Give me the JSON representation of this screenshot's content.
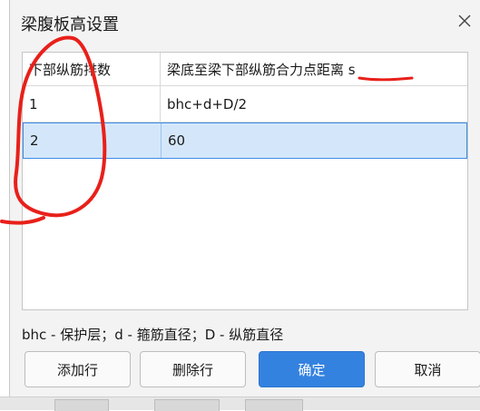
{
  "dialog": {
    "title": "梁腹板高设置",
    "close_icon": "close-icon"
  },
  "table": {
    "columns": [
      "下部纵筋排数",
      "梁底至梁下部纵筋合力点距离 s"
    ],
    "rows": [
      [
        "1",
        "bhc+d+D/2"
      ],
      [
        "2",
        "60"
      ]
    ],
    "selected_row": 2
  },
  "legend": "bhc - 保护层；d - 箍筋直径；D - 纵筋直径",
  "buttons": {
    "add": "添加行",
    "delete": "删除行",
    "ok": "确定",
    "cancel": "取消"
  },
  "colors": {
    "accent": "#3482e0",
    "selection": "#d4e7fa",
    "annotation": "#e8201a"
  }
}
